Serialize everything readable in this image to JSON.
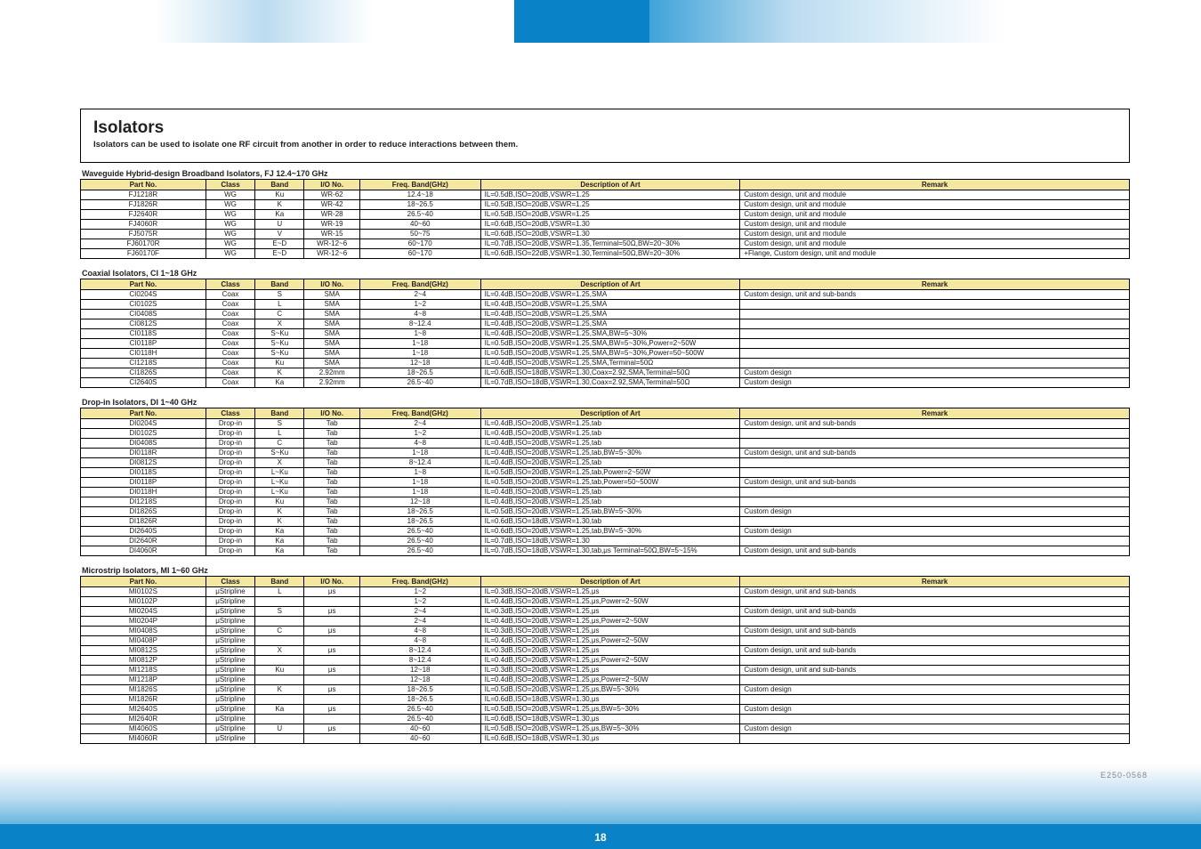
{
  "page_number": "18",
  "lotno": "E250-0568",
  "title": {
    "line1": "Isolators",
    "line2": "Isolators can be used to isolate one RF circuit from another in order to reduce interactions between them."
  },
  "columns": [
    "Part No.",
    "Class",
    "Band",
    "I/O No.",
    "Freq. Band(GHz)",
    "Description of Art",
    "Remark"
  ],
  "sections": [
    {
      "title": "Waveguide Hybrid-design Broadband Isolators, FJ 12.4~170 GHz",
      "rows": [
        [
          "FJ1218R",
          "WG",
          "Ku",
          "WR-62",
          "12.4~18",
          "IL=0.5dB,ISO=20dB,VSWR=1.25",
          "Custom design, unit and module"
        ],
        [
          "FJ1826R",
          "WG",
          "K",
          "WR-42",
          "18~26.5",
          "IL=0.5dB,ISO=20dB,VSWR=1.25",
          "Custom design, unit and module"
        ],
        [
          "FJ2640R",
          "WG",
          "Ka",
          "WR-28",
          "26.5~40",
          "IL=0.5dB,ISO=20dB,VSWR=1.25",
          "Custom design, unit and module"
        ],
        [
          "FJ4060R",
          "WG",
          "U",
          "WR-19",
          "40~60",
          "IL=0.6dB,ISO=20dB,VSWR=1.30",
          "Custom design, unit and module"
        ],
        [
          "FJ5075R",
          "WG",
          "V",
          "WR-15",
          "50~75",
          "IL=0.6dB,ISO=20dB,VSWR=1.30",
          "Custom design, unit and module"
        ],
        [
          "FJ60170R",
          "WG",
          "E~D",
          "WR-12~6",
          "60~170",
          "IL=0.7dB,ISO=20dB,VSWR=1.35,Terminal=50Ω,BW=20~30%",
          "Custom design, unit and module"
        ],
        [
          "FJ60170F",
          "WG",
          "E~D",
          "WR-12~6",
          "60~170",
          "IL=0.6dB,ISO=22dB,VSWR=1.30,Terminal=50Ω,BW=20~30%",
          "+Flange, Custom design, unit and module"
        ]
      ]
    },
    {
      "title": "Coaxial Isolators, CI 1~18 GHz",
      "rows": [
        [
          "CI0204S",
          "Coax",
          "S",
          "SMA",
          "2~4",
          "IL=0.4dB,ISO=20dB,VSWR=1.25,SMA",
          "Custom design, unit and sub-bands"
        ],
        [
          "CI0102S",
          "Coax",
          "L",
          "SMA",
          "1~2",
          "IL=0.4dB,ISO=20dB,VSWR=1.25,SMA",
          ""
        ],
        [
          "CI0408S",
          "Coax",
          "C",
          "SMA",
          "4~8",
          "IL=0.4dB,ISO=20dB,VSWR=1.25,SMA",
          ""
        ],
        [
          "CI0812S",
          "Coax",
          "X",
          "SMA",
          "8~12.4",
          "IL=0.4dB,ISO=20dB,VSWR=1.25,SMA",
          ""
        ],
        [
          "CI0118S",
          "Coax",
          "S~Ku",
          "SMA",
          "1~8",
          "IL=0.4dB,ISO=20dB,VSWR=1.25,SMA,BW=5~30%",
          ""
        ],
        [
          "CI0118P",
          "Coax",
          "S~Ku",
          "SMA",
          "1~18",
          "IL=0.5dB,ISO=20dB,VSWR=1.25,SMA,BW=5~30%,Power=2~50W",
          ""
        ],
        [
          "CI0118H",
          "Coax",
          "S~Ku",
          "SMA",
          "1~18",
          "IL=0.5dB,ISO=20dB,VSWR=1.25,SMA,BW=5~30%,Power=50~500W",
          ""
        ],
        [
          "CI1218S",
          "Coax",
          "Ku",
          "SMA",
          "12~18",
          "IL=0.4dB,ISO=20dB,VSWR=1.25,SMA,Terminal=50Ω",
          ""
        ],
        [
          "CI1826S",
          "Coax",
          "K",
          "2.92mm",
          "18~26.5",
          "IL=0.6dB,ISO=18dB,VSWR=1.30,Coax=2.92,SMA,Terminal=50Ω",
          "Custom design"
        ],
        [
          "CI2640S",
          "Coax",
          "Ka",
          "2.92mm",
          "26.5~40",
          "IL=0.7dB,ISO=18dB,VSWR=1.30,Coax=2.92,SMA,Terminal=50Ω",
          "Custom design"
        ]
      ]
    },
    {
      "title": "Drop-in Isolators, DI 1~40 GHz",
      "rows": [
        [
          "DI0204S",
          "Drop-in",
          "S",
          "Tab",
          "2~4",
          "IL=0.4dB,ISO=20dB,VSWR=1.25,tab",
          "Custom design, unit and sub-bands"
        ],
        [
          "DI0102S",
          "Drop-in",
          "L",
          "Tab",
          "1~2",
          "IL=0.4dB,ISO=20dB,VSWR=1.25,tab",
          ""
        ],
        [
          "DI0408S",
          "Drop-in",
          "C",
          "Tab",
          "4~8",
          "IL=0.4dB,ISO=20dB,VSWR=1.25,tab",
          ""
        ],
        [
          "DI0118R",
          "Drop-in",
          "S~Ku",
          "Tab",
          "1~18",
          "IL=0.4dB,ISO=20dB,VSWR=1.25,tab,BW=5~30%",
          "Custom design, unit and sub-bands"
        ],
        [
          "DI0812S",
          "Drop-in",
          "X",
          "Tab",
          "8~12.4",
          "IL=0.4dB,ISO=20dB,VSWR=1.25,tab",
          ""
        ],
        [
          "DI0118S",
          "Drop-in",
          "L~Ku",
          "Tab",
          "1~8",
          "IL=0.5dB,ISO=20dB,VSWR=1.25,tab,Power=2~50W",
          ""
        ],
        [
          "DI0118P",
          "Drop-in",
          "L~Ku",
          "Tab",
          "1~18",
          "IL=0.5dB,ISO=20dB,VSWR=1.25,tab,Power=50~500W",
          "Custom design, unit and sub-bands"
        ],
        [
          "DI0118H",
          "Drop-in",
          "L~Ku",
          "Tab",
          "1~18",
          "IL=0.4dB,ISO=20dB,VSWR=1.25,tab",
          ""
        ],
        [
          "DI1218S",
          "Drop-in",
          "Ku",
          "Tab",
          "12~18",
          "IL=0.4dB,ISO=20dB,VSWR=1.25,tab",
          ""
        ],
        [
          "DI1826S",
          "Drop-in",
          "K",
          "Tab",
          "18~26.5",
          "IL=0.5dB,ISO=20dB,VSWR=1.25,tab,BW=5~30%",
          "Custom design"
        ],
        [
          "DI1826R",
          "Drop-in",
          "K",
          "Tab",
          "18~26.5",
          "IL=0.6dB,ISO=18dB,VSWR=1.30,tab",
          ""
        ],
        [
          "DI2640S",
          "Drop-in",
          "Ka",
          "Tab",
          "26.5~40",
          "IL=0.6dB,ISO=20dB,VSWR=1.25,tab,BW=5~30%",
          "Custom design"
        ],
        [
          "DI2640R",
          "Drop-in",
          "Ka",
          "Tab",
          "26.5~40",
          "IL=0.7dB,ISO=18dB,VSWR=1.30",
          ""
        ],
        [
          "DI4060R",
          "Drop-in",
          "Ka",
          "Tab",
          "26.5~40",
          "IL=0.7dB,ISO=18dB,VSWR=1.30,tab,μs Terminal=50Ω,BW=5~15%",
          "Custom design, unit and sub-bands"
        ]
      ]
    },
    {
      "title": "Microstrip Isolators, MI 1~60 GHz",
      "rows": [
        [
          "MI0102S",
          "μStripline",
          "L",
          "μs",
          "1~2",
          "IL=0.3dB,ISO=20dB,VSWR=1.25,μs",
          "Custom design, unit and sub-bands"
        ],
        [
          "MI0102P",
          "μStripline",
          "",
          "",
          "1~2",
          "IL=0.4dB,ISO=20dB,VSWR=1.25,μs,Power=2~50W",
          ""
        ],
        [
          "MI0204S",
          "μStripline",
          "S",
          "μs",
          "2~4",
          "IL=0.3dB,ISO=20dB,VSWR=1.25,μs",
          "Custom design, unit and sub-bands"
        ],
        [
          "MI0204P",
          "μStripline",
          "",
          "",
          "2~4",
          "IL=0.4dB,ISO=20dB,VSWR=1.25,μs,Power=2~50W",
          ""
        ],
        [
          "MI0408S",
          "μStripline",
          "C",
          "μs",
          "4~8",
          "IL=0.3dB,ISO=20dB,VSWR=1.25,μs",
          "Custom design, unit and sub-bands"
        ],
        [
          "MI0408P",
          "μStripline",
          "",
          "",
          "4~8",
          "IL=0.4dB,ISO=20dB,VSWR=1.25,μs,Power=2~50W",
          ""
        ],
        [
          "MI0812S",
          "μStripline",
          "X",
          "μs",
          "8~12.4",
          "IL=0.3dB,ISO=20dB,VSWR=1.25,μs",
          "Custom design, unit and sub-bands"
        ],
        [
          "MI0812P",
          "μStripline",
          "",
          "",
          "8~12.4",
          "IL=0.4dB,ISO=20dB,VSWR=1.25,μs,Power=2~50W",
          ""
        ],
        [
          "MI1218S",
          "μStripline",
          "Ku",
          "μs",
          "12~18",
          "IL=0.3dB,ISO=20dB,VSWR=1.25,μs",
          "Custom design, unit and sub-bands"
        ],
        [
          "MI1218P",
          "μStripline",
          "",
          "",
          "12~18",
          "IL=0.4dB,ISO=20dB,VSWR=1.25,μs,Power=2~50W",
          ""
        ],
        [
          "MI1826S",
          "μStripline",
          "K",
          "μs",
          "18~26.5",
          "IL=0.5dB,ISO=20dB,VSWR=1.25,μs,BW=5~30%",
          "Custom design"
        ],
        [
          "MI1826R",
          "μStripline",
          "",
          "",
          "18~26.5",
          "IL=0.6dB,ISO=18dB,VSWR=1.30,μs",
          ""
        ],
        [
          "MI2640S",
          "μStripline",
          "Ka",
          "μs",
          "26.5~40",
          "IL=0.5dB,ISO=20dB,VSWR=1.25,μs,BW=5~30%",
          "Custom design"
        ],
        [
          "MI2640R",
          "μStripline",
          "",
          "",
          "26.5~40",
          "IL=0.6dB,ISO=18dB,VSWR=1.30,μs",
          ""
        ],
        [
          "MI4060S",
          "μStripline",
          "U",
          "μs",
          "40~60",
          "IL=0.5dB,ISO=20dB,VSWR=1.25,μs,BW=5~30%",
          "Custom design"
        ],
        [
          "MI4060R",
          "μStripline",
          "",
          "",
          "40~60",
          "IL=0.6dB,ISO=18dB,VSWR=1.30,μs",
          ""
        ]
      ]
    }
  ]
}
